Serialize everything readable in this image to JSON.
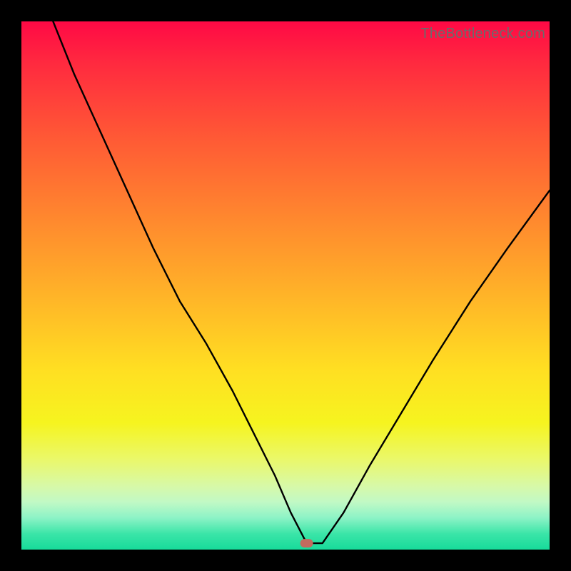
{
  "watermark": "TheBottleneck.com",
  "chart_data": {
    "type": "line",
    "title": "",
    "xlabel": "",
    "ylabel": "",
    "xlim": [
      0,
      100
    ],
    "ylim": [
      0,
      100
    ],
    "grid": false,
    "legend": false,
    "background": "red-yellow-green vertical gradient",
    "marker": {
      "x": 54,
      "y": 1.2,
      "color": "#c26b5e"
    },
    "series": [
      {
        "name": "curve",
        "x": [
          6,
          10,
          15,
          20,
          25,
          30,
          35,
          40,
          44,
          48,
          51,
          54,
          57,
          61,
          66,
          72,
          78,
          85,
          92,
          100
        ],
        "values": [
          100,
          90,
          79,
          68,
          57,
          47,
          39,
          30,
          22,
          14,
          7,
          1.2,
          1.2,
          7,
          16,
          26,
          36,
          47,
          57,
          68
        ]
      }
    ]
  }
}
